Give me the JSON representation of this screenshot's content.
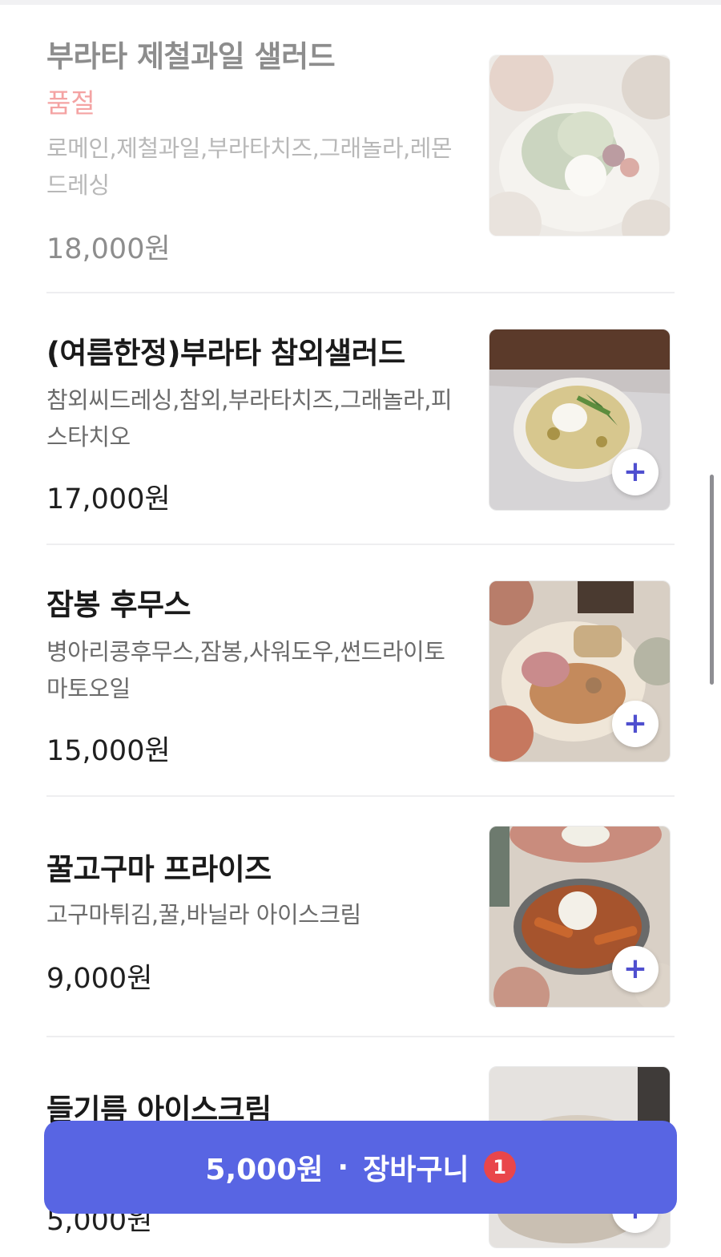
{
  "colors": {
    "accent": "#5865e3",
    "badge": "#e9464b",
    "soldout_label": "#f4a3a3",
    "plus_icon": "#4f4fcf"
  },
  "menu": {
    "items": [
      {
        "name": "부라타 제철과일 샐러드",
        "status": "품절",
        "description": "로메인,제철과일,부라타치즈,그래놀라,레몬드레싱",
        "price": "18,000원",
        "image_icon": "salad-photo"
      },
      {
        "name": "(여름한정)부라타 참외샐러드",
        "description": "참외씨드레싱,참외,부라타치즈,그래놀라,피스타치오",
        "price": "17,000원",
        "image_icon": "melon-salad-photo",
        "add_icon": "plus-icon"
      },
      {
        "name": "잠봉 후무스",
        "description": "병아리콩후무스,잠봉,사워도우,썬드라이토마토오일",
        "price": "15,000원",
        "image_icon": "hummus-plate-photo",
        "add_icon": "plus-icon"
      },
      {
        "name": "꿀고구마 프라이즈",
        "description": "고구마튀김,꿀,바닐라 아이스크림",
        "price": "9,000원",
        "image_icon": "sweet-potato-fries-photo",
        "add_icon": "plus-icon"
      },
      {
        "name": "들기름 아이스크림",
        "price": "5,000원",
        "image_icon": "ice-cream-bowl-photo",
        "add_icon": "plus-icon"
      }
    ]
  },
  "cart": {
    "total": "5,000원",
    "separator": "·",
    "label": "장바구니",
    "count": "1"
  }
}
